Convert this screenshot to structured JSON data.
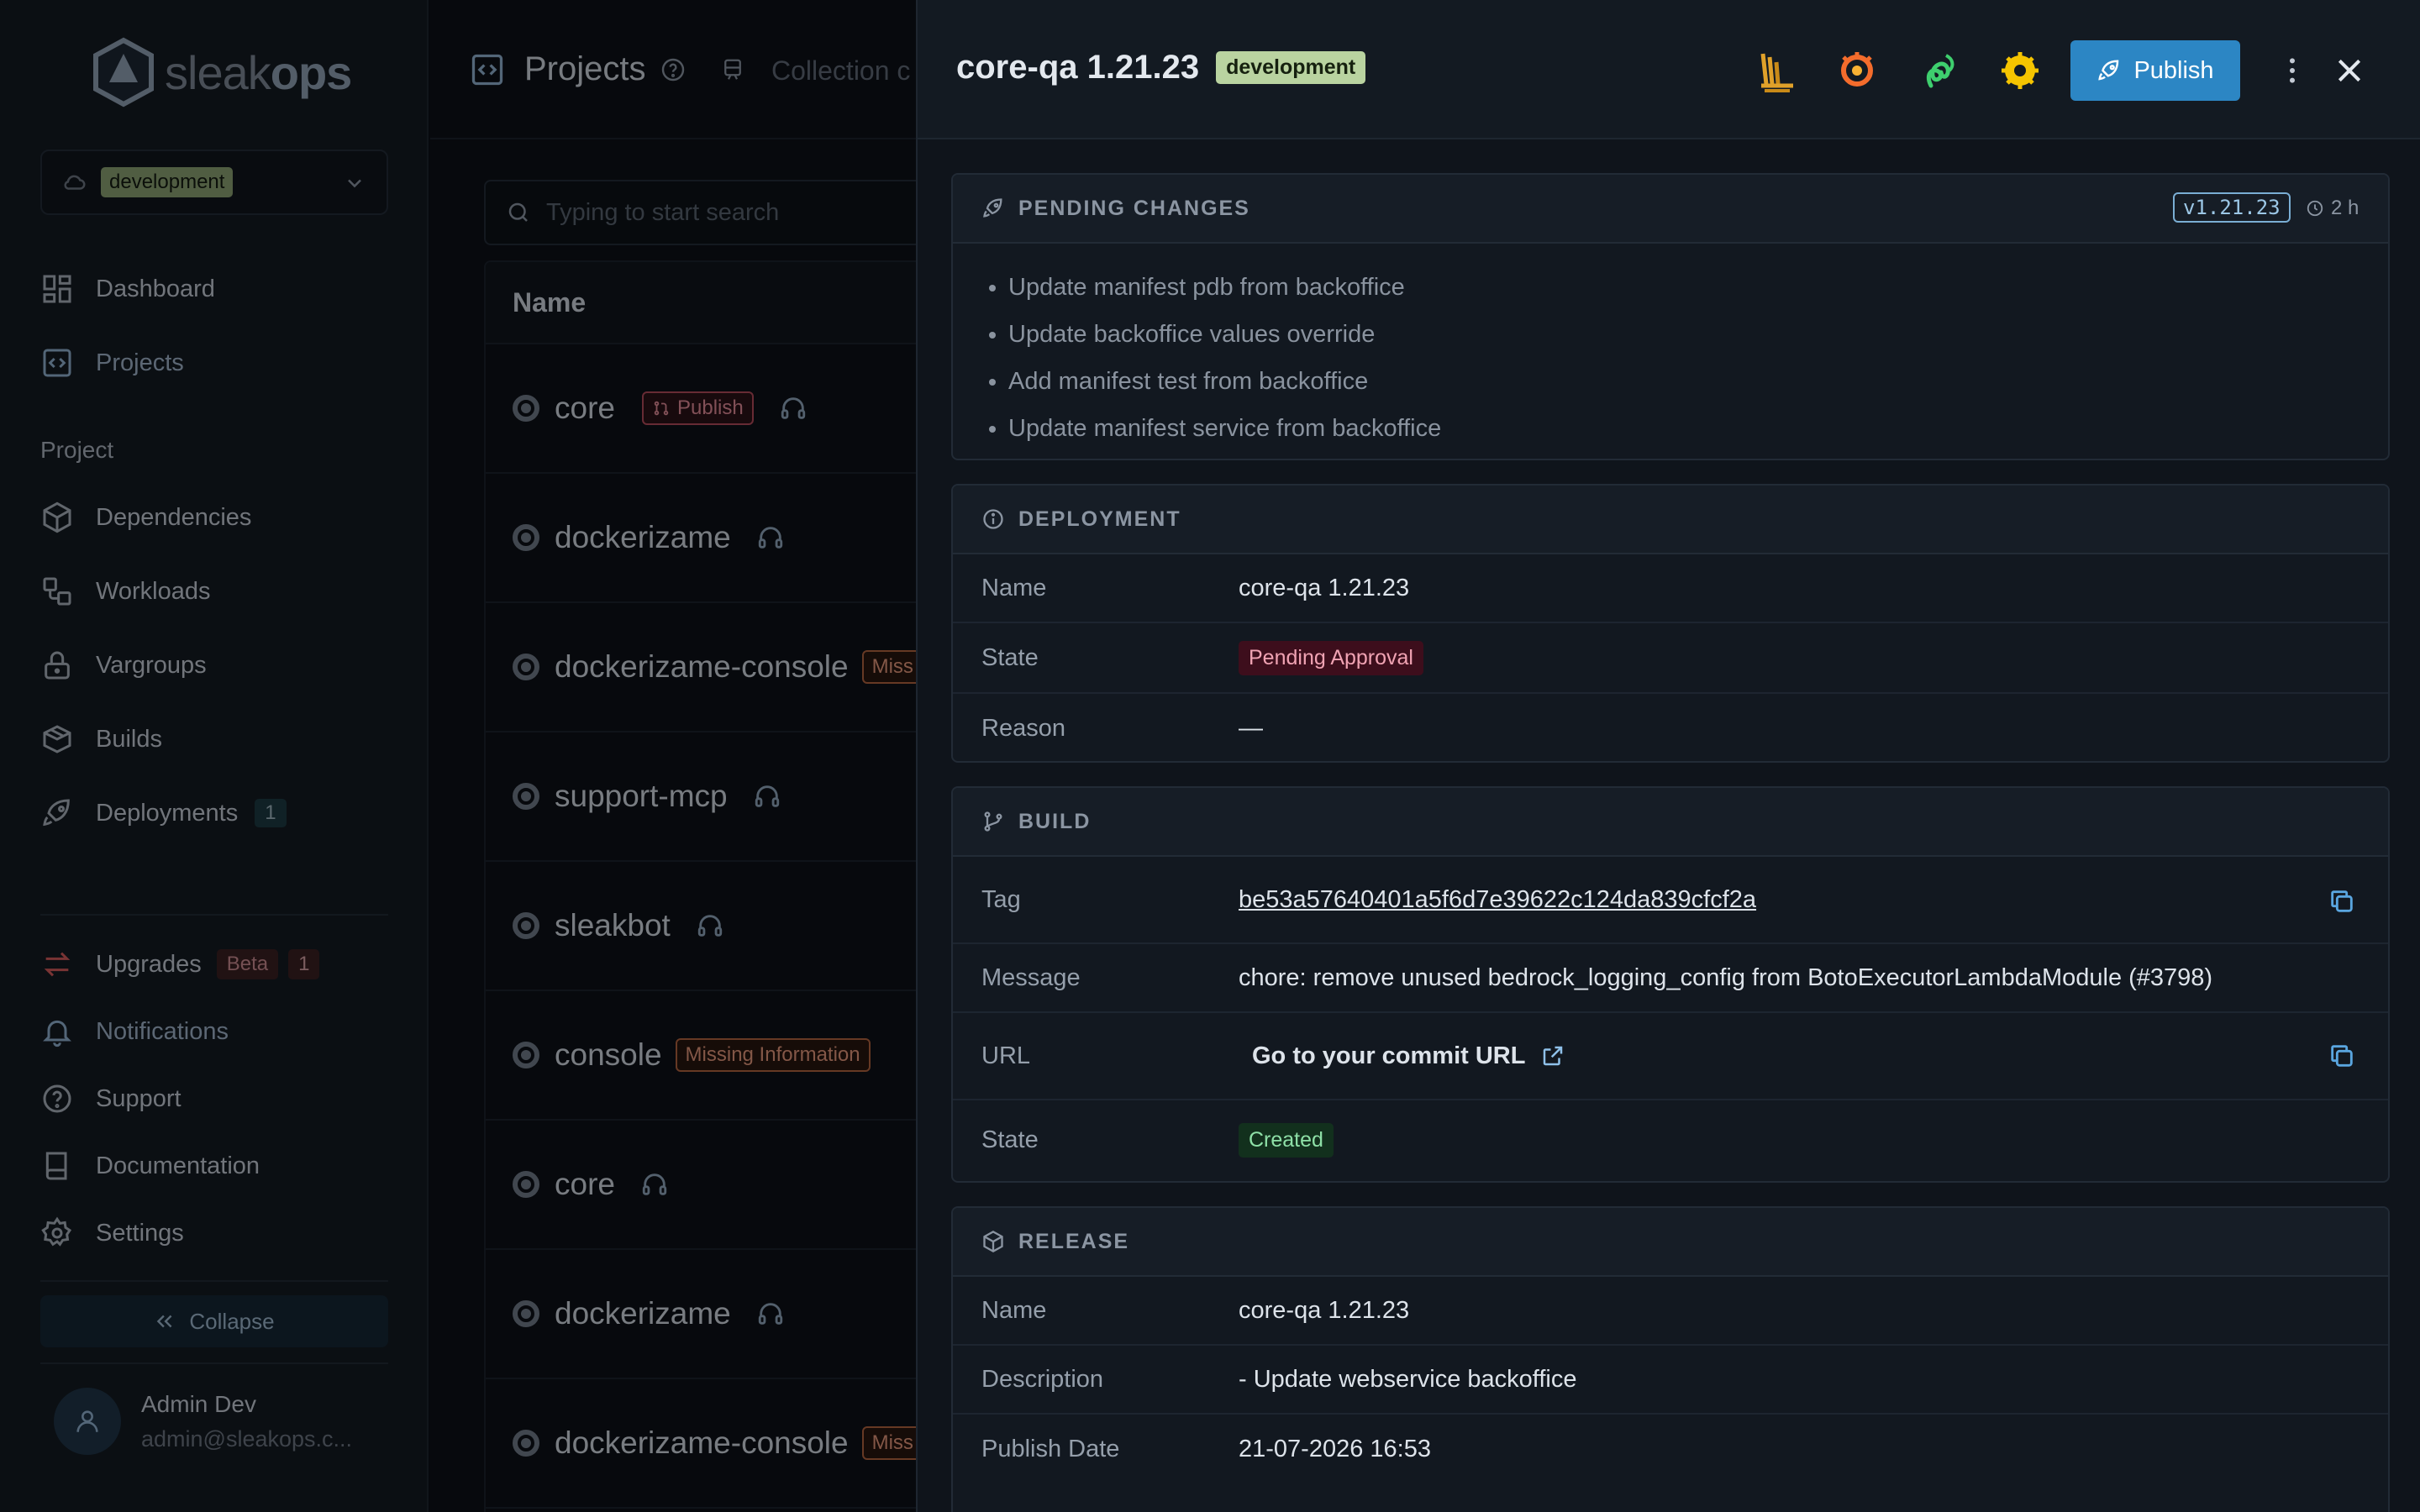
{
  "colors": {
    "accent": "#2c86c4",
    "env_badge": "#b9d3a0",
    "pending": "#3d0e1c",
    "created": "#12301d"
  },
  "sidebar": {
    "logo": {
      "part1": "sleak",
      "part2": "ops"
    },
    "environment": "development",
    "nav_main": [
      {
        "label": "Dashboard",
        "icon": "dashboard-icon"
      },
      {
        "label": "Projects",
        "icon": "projects-icon"
      }
    ],
    "section_label": "Project",
    "nav_project": [
      {
        "label": "Dependencies",
        "icon": "cube-icon"
      },
      {
        "label": "Workloads",
        "icon": "workloads-icon"
      },
      {
        "label": "Vargroups",
        "icon": "lock-icon"
      },
      {
        "label": "Builds",
        "icon": "builds-icon"
      },
      {
        "label": "Deployments",
        "icon": "rocket-icon",
        "badge": "1"
      }
    ],
    "upgrades": {
      "label": "Upgrades",
      "beta": "Beta",
      "count": "1"
    },
    "nav_bottom": [
      {
        "label": "Notifications",
        "icon": "bell-icon"
      },
      {
        "label": "Support",
        "icon": "help-icon"
      },
      {
        "label": "Documentation",
        "icon": "book-icon"
      },
      {
        "label": "Settings",
        "icon": "gear-icon"
      }
    ],
    "collapse_label": "Collapse",
    "user": {
      "name": "Admin Dev",
      "email": "admin@sleakops.c..."
    }
  },
  "main": {
    "title": "Projects",
    "collection_tab": "Collection c",
    "search": {
      "placeholder": "Typing to start search",
      "shortcut": "⌘"
    },
    "table": {
      "header": "Name",
      "rows": [
        {
          "name": "core",
          "tag": "Publish",
          "tag_type": "publish",
          "headset": true
        },
        {
          "name": "dockerizame",
          "headset": true
        },
        {
          "name": "dockerizame-console",
          "tag": "Miss",
          "tag_type": "missing"
        },
        {
          "name": "support-mcp",
          "headset": true
        },
        {
          "name": "sleakbot",
          "headset": true
        },
        {
          "name": "console",
          "tag": "Missing Information",
          "tag_type": "missing"
        },
        {
          "name": "core",
          "headset": true
        },
        {
          "name": "dockerizame",
          "headset": true
        },
        {
          "name": "dockerizame-console",
          "tag": "Miss",
          "tag_type": "missing"
        }
      ]
    }
  },
  "drawer": {
    "title": "core-qa 1.21.23",
    "env": "development",
    "publish_label": "Publish",
    "pending": {
      "title": "PENDING CHANGES",
      "version": "v1.21.23",
      "ago": "2 h",
      "items": [
        "Update manifest pdb from backoffice",
        "Update backoffice values override",
        "Add manifest test from backoffice",
        "Update manifest service from backoffice"
      ]
    },
    "deployment": {
      "title": "DEPLOYMENT",
      "name_label": "Name",
      "name": "core-qa 1.21.23",
      "state_label": "State",
      "state": "Pending Approval",
      "reason_label": "Reason",
      "reason": "—"
    },
    "build": {
      "title": "BUILD",
      "tag_label": "Tag",
      "tag": "be53a57640401a5f6d7e39622c124da839cfcf2a",
      "message_label": "Message",
      "message": "chore: remove unused bedrock_logging_config from BotoExecutorLambdaModule (#3798)",
      "url_label": "URL",
      "url_text": "Go to your commit URL",
      "state_label": "State",
      "state": "Created"
    },
    "release": {
      "title": "RELEASE",
      "name_label": "Name",
      "name": "core-qa 1.21.23",
      "description_label": "Description",
      "description": "- Update webservice backoffice",
      "publish_date_label": "Publish Date",
      "publish_date": "21-07-2026 16:53"
    }
  }
}
